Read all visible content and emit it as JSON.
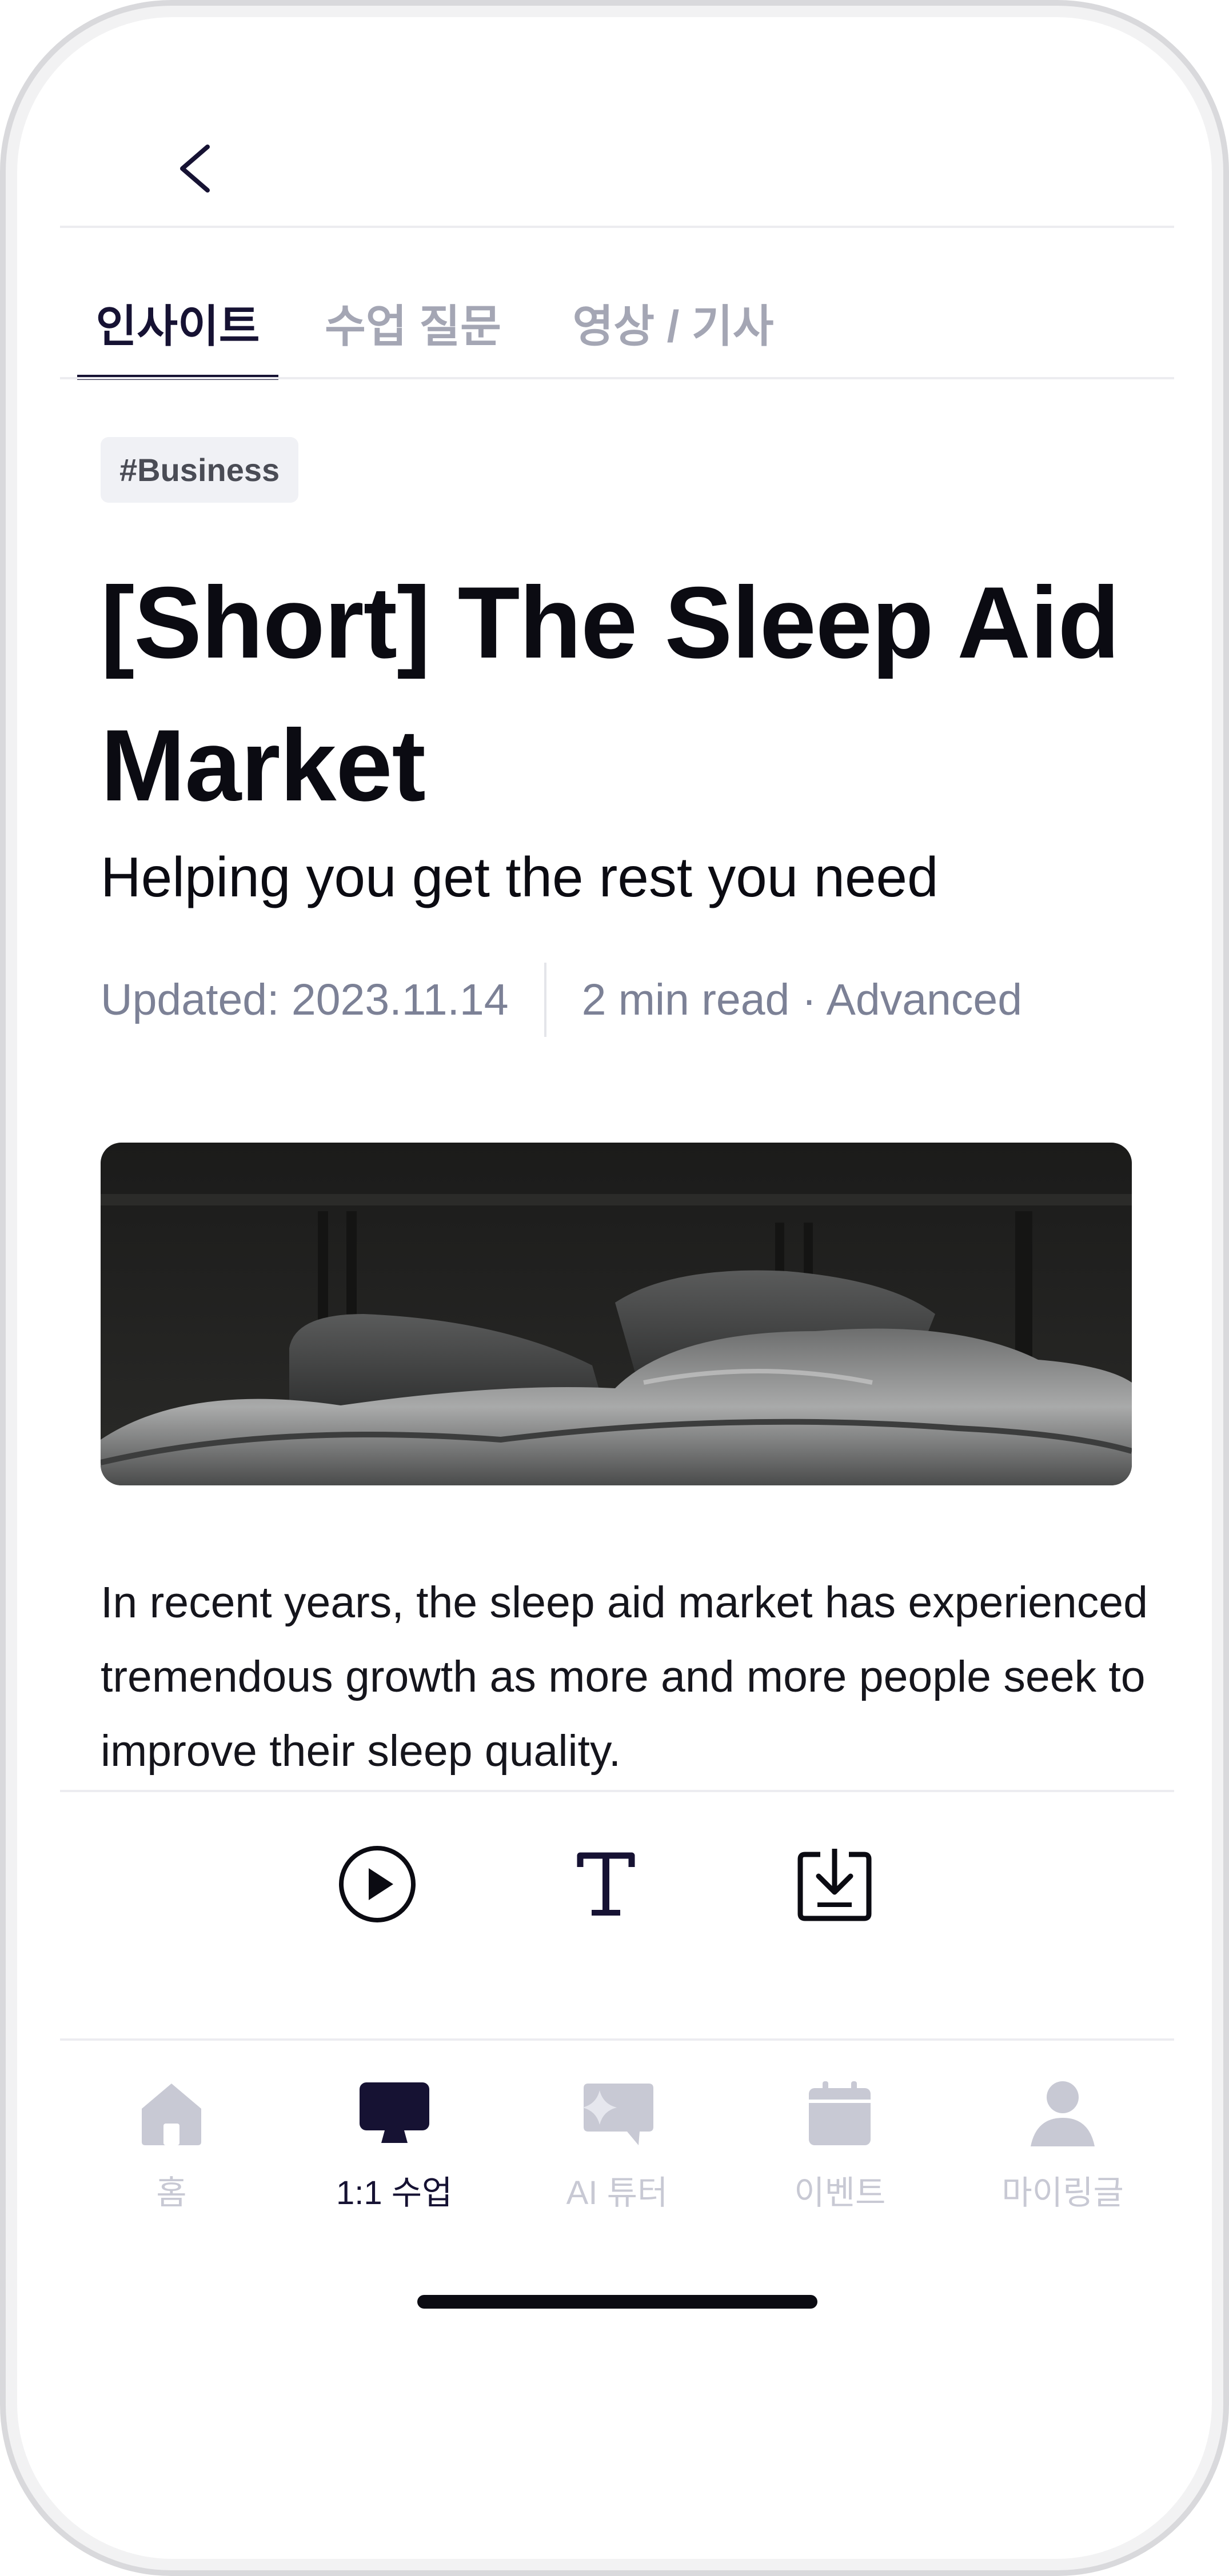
{
  "tabs": [
    {
      "label": "인사이트",
      "active": true
    },
    {
      "label": "수업 질문",
      "active": false
    },
    {
      "label": "영상 / 기사",
      "active": false
    }
  ],
  "article": {
    "tag": "#Business",
    "title": "[Short] The Sleep Aid Market",
    "subtitle": "Helping you get the rest you need",
    "updated": "Updated: 2023.11.14",
    "read_info": "2 min read · Advanced",
    "body": "In recent years, the sleep aid market has experienced tremendous growth as more and more people seek to improve their sleep quality."
  },
  "actions": [
    {
      "icon": "play-icon"
    },
    {
      "icon": "text-size-icon"
    },
    {
      "icon": "download-icon"
    }
  ],
  "nav": [
    {
      "label": "홈",
      "icon": "home-icon",
      "active": false
    },
    {
      "label": "1:1 수업",
      "icon": "monitor-icon",
      "active": true
    },
    {
      "label": "AI 튜터",
      "icon": "ai-chat-icon",
      "active": false
    },
    {
      "label": "이벤트",
      "icon": "calendar-icon",
      "active": false
    },
    {
      "label": "마이링글",
      "icon": "profile-icon",
      "active": false
    }
  ],
  "colors": {
    "accent": "#161233",
    "inactive": "#c8c9d4",
    "muted_text": "#7c8196"
  }
}
